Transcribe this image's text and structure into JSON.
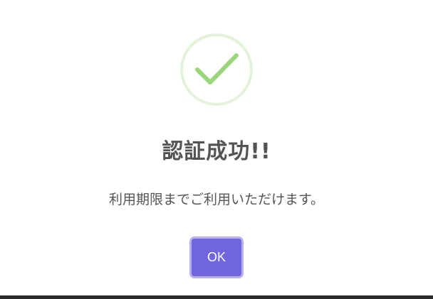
{
  "dialog": {
    "icon": "success-check-icon",
    "title": "認証成功!!",
    "message": "利用期限までご利用いただけます。",
    "ok_label": "OK"
  },
  "colors": {
    "check_ring": "#e3f3d9",
    "check_mark": "#98d67a",
    "title_text": "#545454",
    "button_bg": "#7166e0",
    "button_border": "#b9b0f2",
    "bottom_bar": "#2b2b2b"
  }
}
